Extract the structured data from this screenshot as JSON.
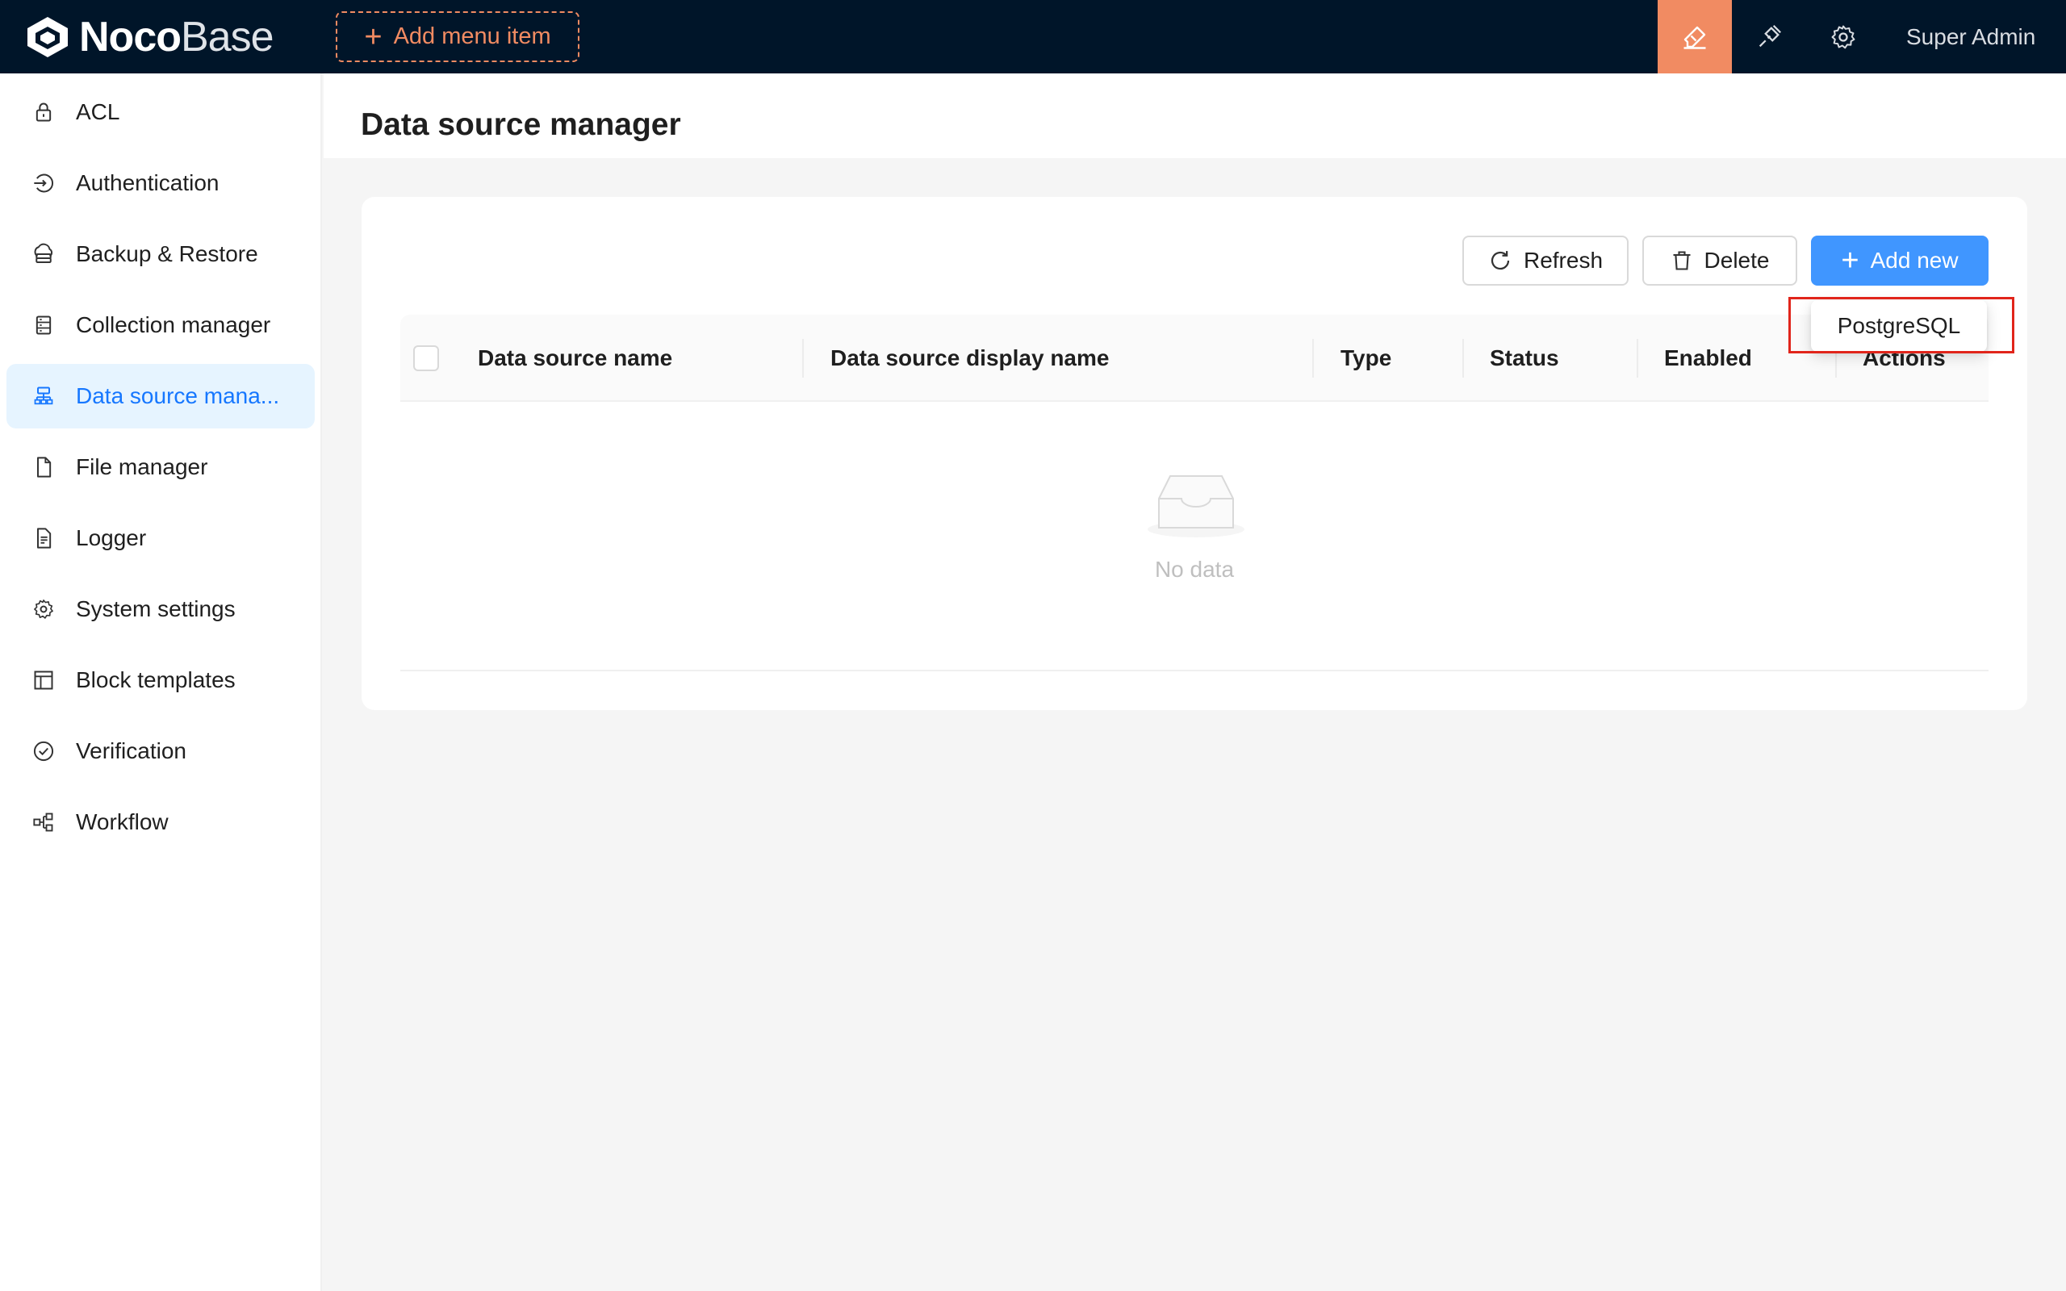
{
  "topbar": {
    "logo_bold": "Noco",
    "logo_light": "Base",
    "add_menu_label": "Add menu item",
    "user_name": "Super Admin",
    "icons": [
      "highlighter-icon",
      "plug-icon",
      "gear-icon"
    ],
    "accent_color": "#f18b62",
    "bg_color": "#001529"
  },
  "sidebar": {
    "items": [
      {
        "label": "ACL",
        "icon": "lock-icon"
      },
      {
        "label": "Authentication",
        "icon": "login-icon"
      },
      {
        "label": "Backup & Restore",
        "icon": "cloud-server-icon"
      },
      {
        "label": "Collection manager",
        "icon": "database-icon"
      },
      {
        "label": "Data source mana...",
        "icon": "cluster-icon",
        "selected": true
      },
      {
        "label": "File manager",
        "icon": "file-icon"
      },
      {
        "label": "Logger",
        "icon": "file-text-icon"
      },
      {
        "label": "System settings",
        "icon": "setting-icon"
      },
      {
        "label": "Block templates",
        "icon": "layout-icon"
      },
      {
        "label": "Verification",
        "icon": "check-circle-icon"
      },
      {
        "label": "Workflow",
        "icon": "partition-icon"
      }
    ]
  },
  "main": {
    "title": "Data source manager",
    "buttons": {
      "refresh": "Refresh",
      "delete": "Delete",
      "add_new": "Add new"
    },
    "table": {
      "columns": [
        "Data source name",
        "Data source display name",
        "Type",
        "Status",
        "Enabled",
        "Actions"
      ],
      "empty_text": "No data"
    },
    "dropdown": {
      "options": [
        "PostgreSQL"
      ]
    },
    "primary_color": "#4096ff",
    "highlight_color": "#e1251b"
  }
}
